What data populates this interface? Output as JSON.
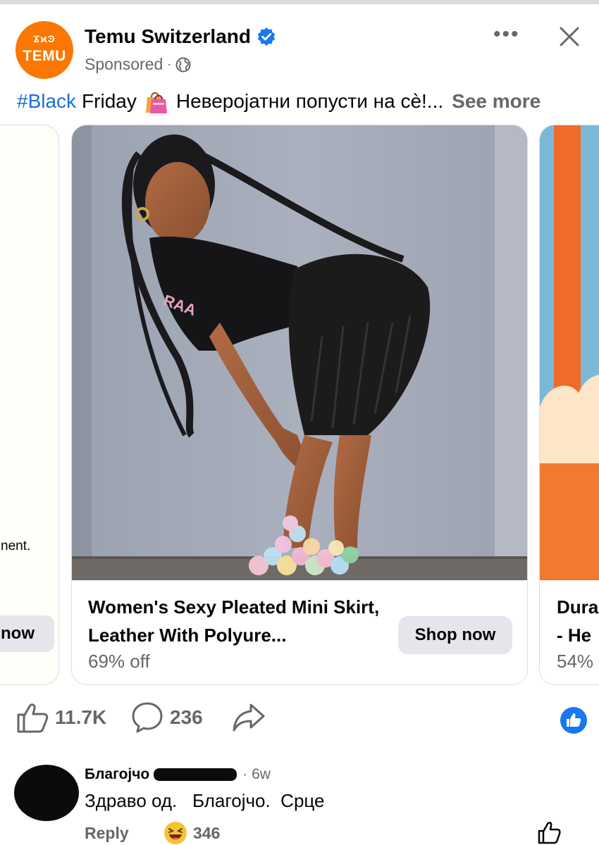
{
  "post": {
    "page_name": "Temu Switzerland",
    "sponsored": "Sponsored",
    "separator": "·",
    "logo_icons": "ϪϰϿ",
    "logo_text": "TEMU",
    "more": "•••",
    "caption_hashtag": "#Black",
    "caption_word": "Friday",
    "caption_rest": "Неверојатни попусти на сè!...",
    "see_more": "See more"
  },
  "carousel": {
    "left_card": {
      "text": "nent.",
      "button": "now"
    },
    "main_card": {
      "title": "Women's Sexy Pleated Mini Skirt, Leather With Polyure...",
      "discount": "69% off",
      "button": "Shop now"
    },
    "right_card": {
      "title_line1": "Dura",
      "title_line2": "- He",
      "discount": "54%"
    }
  },
  "reactions": {
    "likes": "11.7K",
    "comments": "236"
  },
  "comment": {
    "author": "Благојчо",
    "time": "· 6w",
    "text": "Здраво од.   Благојчо.  Срце",
    "reply": "Reply",
    "reaction_count": "346"
  },
  "colors": {
    "temu_orange": "#fb7701",
    "link_blue": "#1b6fd6",
    "facebook_blue": "#1877f2",
    "secondary_text": "#65676b",
    "button_gray": "#e4e6eb"
  },
  "icons": [
    "verified-badge-icon",
    "globe-icon",
    "more-options-icon",
    "close-icon",
    "shopping-bags-icon",
    "like-icon",
    "comment-icon",
    "share-icon",
    "like-reaction-badge-icon",
    "laughing-emoji-icon"
  ]
}
